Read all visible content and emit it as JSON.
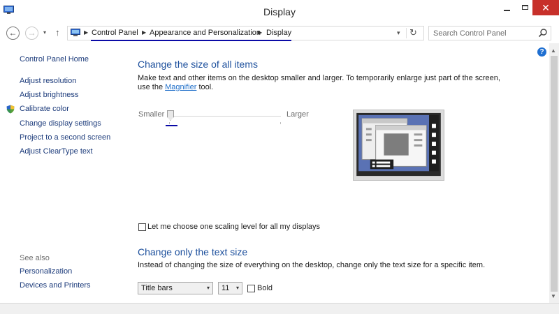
{
  "window": {
    "title": "Display",
    "close_symbol": "✕"
  },
  "address": {
    "crumbs": [
      "Control Panel",
      "Appearance and Personalization",
      "Display"
    ],
    "search_placeholder": "Search Control Panel"
  },
  "left_nav": {
    "home": "Control Panel Home",
    "links": [
      "Adjust resolution",
      "Adjust brightness",
      "Calibrate color",
      "Change display settings",
      "Project to a second screen",
      "Adjust ClearType text"
    ],
    "see_also_label": "See also",
    "see_also": [
      "Personalization",
      "Devices and Printers"
    ]
  },
  "main": {
    "size_heading": "Change the size of all items",
    "size_desc_line1": "Make text and other items on the desktop smaller and larger. To temporarily enlarge just part of the screen,",
    "size_desc_pre": "use the ",
    "magnifier_link": "Magnifier",
    "size_desc_post": " tool.",
    "slider": {
      "min_label": "Smaller",
      "max_label": "Larger",
      "value_fraction": 0.0
    },
    "one_level_checkbox": {
      "label": "Let me choose one scaling level for all my displays",
      "checked": false
    },
    "text_heading": "Change only the text size",
    "text_desc": "Instead of changing the size of everything on the desktop, change only the text size for a specific item.",
    "item_select": "Title bars",
    "size_select": "11",
    "bold_checkbox": {
      "label": "Bold",
      "checked": false
    }
  },
  "icons": {
    "help": "?",
    "refresh": "↻",
    "back": "←",
    "forward": "→",
    "up": "↑",
    "dropdown": "▾"
  },
  "colors": {
    "heading": "#1c4f9c",
    "link": "#1b3a7a",
    "close_button": "#c7302a",
    "preview_blue": "#5a72b4"
  }
}
